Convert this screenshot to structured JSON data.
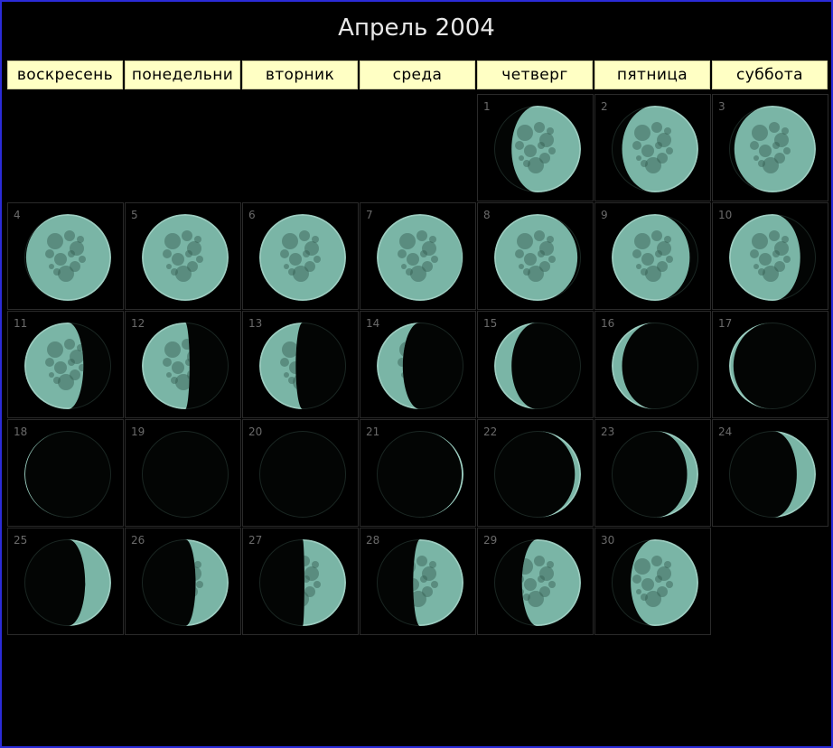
{
  "title": "Апрель 2004",
  "weekdays": [
    "воскресень",
    "понедельни",
    "вторник",
    "среда",
    "четверг",
    "пятница",
    "суббота"
  ],
  "first_weekday_index": 4,
  "colors": {
    "moon_fill": "#7ab5a6",
    "moon_dark": "#335a50",
    "frame": "#2b2bd8",
    "header_bg": "#ffffc4"
  },
  "days": [
    {
      "day": "1",
      "illum": 0.8,
      "waxing": true
    },
    {
      "day": "2",
      "illum": 0.88,
      "waxing": true
    },
    {
      "day": "3",
      "illum": 0.94,
      "waxing": true
    },
    {
      "day": "4",
      "illum": 0.98,
      "waxing": true
    },
    {
      "day": "5",
      "illum": 1.0,
      "waxing": true
    },
    {
      "day": "6",
      "illum": 1.0,
      "waxing": false
    },
    {
      "day": "7",
      "illum": 0.99,
      "waxing": false
    },
    {
      "day": "8",
      "illum": 0.96,
      "waxing": false
    },
    {
      "day": "9",
      "illum": 0.9,
      "waxing": false
    },
    {
      "day": "10",
      "illum": 0.82,
      "waxing": false
    },
    {
      "day": "11",
      "illum": 0.68,
      "waxing": false
    },
    {
      "day": "12",
      "illum": 0.55,
      "waxing": false
    },
    {
      "day": "13",
      "illum": 0.42,
      "waxing": false
    },
    {
      "day": "14",
      "illum": 0.3,
      "waxing": false
    },
    {
      "day": "15",
      "illum": 0.2,
      "waxing": false
    },
    {
      "day": "16",
      "illum": 0.12,
      "waxing": false
    },
    {
      "day": "17",
      "illum": 0.05,
      "waxing": false
    },
    {
      "day": "18",
      "illum": 0.01,
      "waxing": false
    },
    {
      "day": "19",
      "illum": 0.0,
      "waxing": true
    },
    {
      "day": "20",
      "illum": 0.0,
      "waxing": true
    },
    {
      "day": "21",
      "illum": 0.02,
      "waxing": true
    },
    {
      "day": "22",
      "illum": 0.07,
      "waxing": true
    },
    {
      "day": "23",
      "illum": 0.13,
      "waxing": true
    },
    {
      "day": "24",
      "illum": 0.22,
      "waxing": true
    },
    {
      "day": "25",
      "illum": 0.3,
      "waxing": true
    },
    {
      "day": "26",
      "illum": 0.38,
      "waxing": true
    },
    {
      "day": "27",
      "illum": 0.48,
      "waxing": true
    },
    {
      "day": "28",
      "illum": 0.58,
      "waxing": true
    },
    {
      "day": "29",
      "illum": 0.68,
      "waxing": true
    },
    {
      "day": "30",
      "illum": 0.78,
      "waxing": true
    }
  ]
}
